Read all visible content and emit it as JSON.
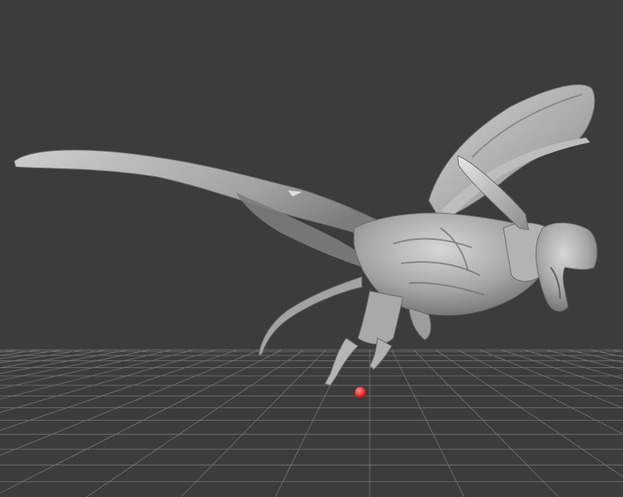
{
  "viewport": {
    "background": "#3c3c3c",
    "grid_color": "#8a8a8a",
    "model_base_color": "#9e9e9e",
    "model_highlight_color": "#d9d9d9",
    "model_shadow_color": "#5e5e5e",
    "pivot_color": "#ff3b3b",
    "model_name": "",
    "grid_visible": true
  }
}
